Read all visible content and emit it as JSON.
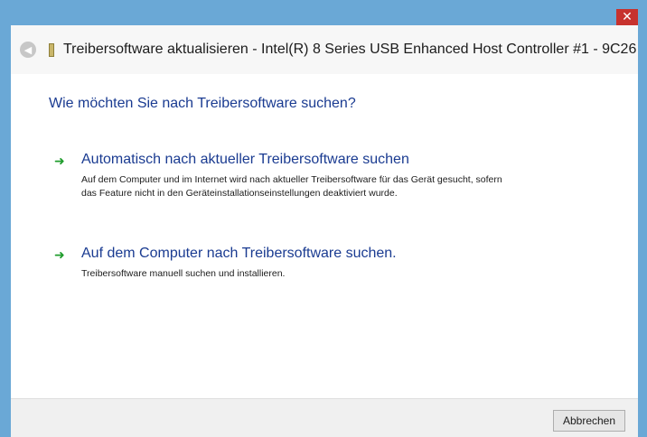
{
  "window": {
    "title": "Treibersoftware aktualisieren - Intel(R) 8 Series USB Enhanced Host Controller #1 - 9C26",
    "close_glyph": "✕"
  },
  "main": {
    "question": "Wie möchten Sie nach Treibersoftware suchen?",
    "options": [
      {
        "title": "Automatisch nach aktueller Treibersoftware suchen",
        "description": "Auf dem Computer und im Internet wird nach aktueller Treibersoftware für das Gerät gesucht, sofern das Feature nicht in den Geräteinstallationseinstellungen deaktiviert wurde."
      },
      {
        "title": "Auf dem Computer nach Treibersoftware suchen.",
        "description": "Treibersoftware manuell suchen und installieren."
      }
    ]
  },
  "footer": {
    "cancel_label": "Abbrechen"
  },
  "icons": {
    "back": "back-arrow-icon",
    "option_arrow": "green-arrow-icon",
    "device": "usb-device-icon"
  },
  "colors": {
    "frame": "#6aa8d6",
    "link_blue": "#1a3b91",
    "arrow_green": "#1f9c2c",
    "close_red": "#c7322e"
  }
}
